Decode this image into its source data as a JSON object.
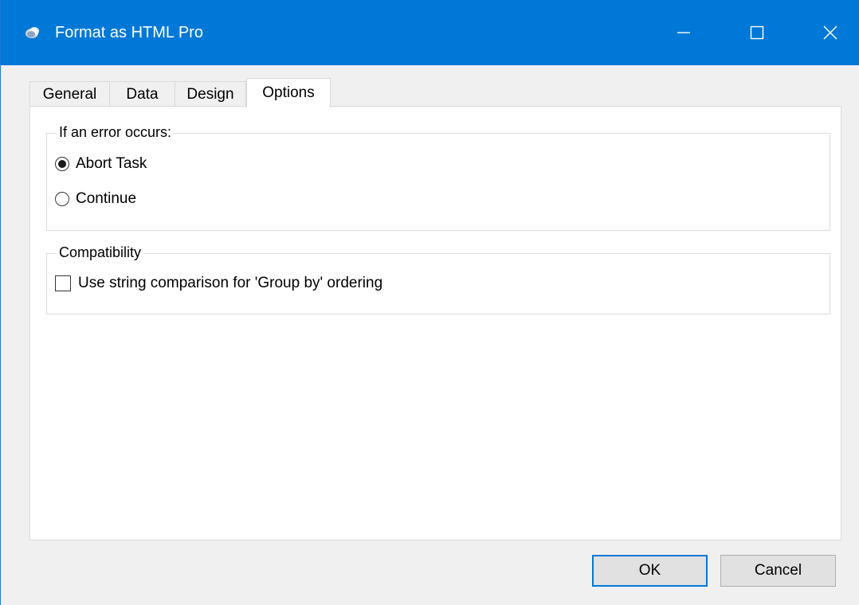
{
  "window": {
    "title": "Format as HTML Pro",
    "app_icon": "blue-sphere-app-icon",
    "controls": [
      "minimize-icon",
      "maximize-icon",
      "close-icon"
    ],
    "accent_color": "#0078d7"
  },
  "tabs": [
    {
      "label": "General",
      "active": false
    },
    {
      "label": "Data",
      "active": false
    },
    {
      "label": "Design",
      "active": false
    },
    {
      "label": "Options",
      "active": true
    }
  ],
  "error_group": {
    "legend": "If an error occurs:",
    "options": [
      {
        "label": "Abort Task",
        "selected": true
      },
      {
        "label": "Continue",
        "selected": false
      }
    ]
  },
  "compat_group": {
    "legend": "Compatibility",
    "checkbox_label": "Use string comparison for 'Group by' ordering",
    "checked": false
  },
  "buttons": {
    "ok": "OK",
    "cancel": "Cancel"
  }
}
